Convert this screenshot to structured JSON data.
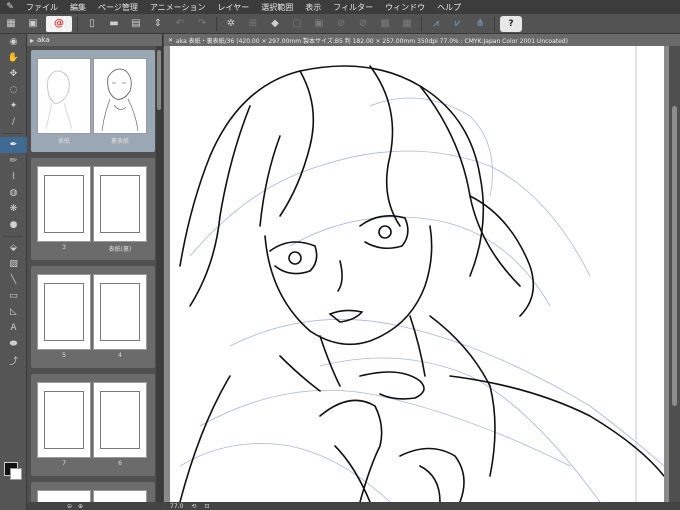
{
  "menu": {
    "items": [
      "ファイル",
      "編集",
      "ページ管理",
      "アニメーション",
      "レイヤー",
      "選択範囲",
      "表示",
      "フィルター",
      "ウィンドウ",
      "ヘルプ"
    ]
  },
  "toolbar": {
    "help_label": "?"
  },
  "pages_panel": {
    "tab_label": "aka",
    "spreads": [
      {
        "left_label": "表紙",
        "right_label": "裏表紙"
      },
      {
        "left_label": "3",
        "right_label": "表紙(裏)"
      },
      {
        "left_label": "5",
        "right_label": "4"
      },
      {
        "left_label": "7",
        "right_label": "6"
      },
      {
        "left_label": "",
        "right_label": ""
      }
    ]
  },
  "canvas": {
    "tab_title": "aka 表紙・裏表紙/36 (420.00 × 297.00mm 製本サイズ:B5 判 182.00 × 257.00mm 350dpi 77.0% : CMYK:Japan Color 2001 Uncoated)"
  },
  "status": {
    "zoom": "77.0"
  }
}
